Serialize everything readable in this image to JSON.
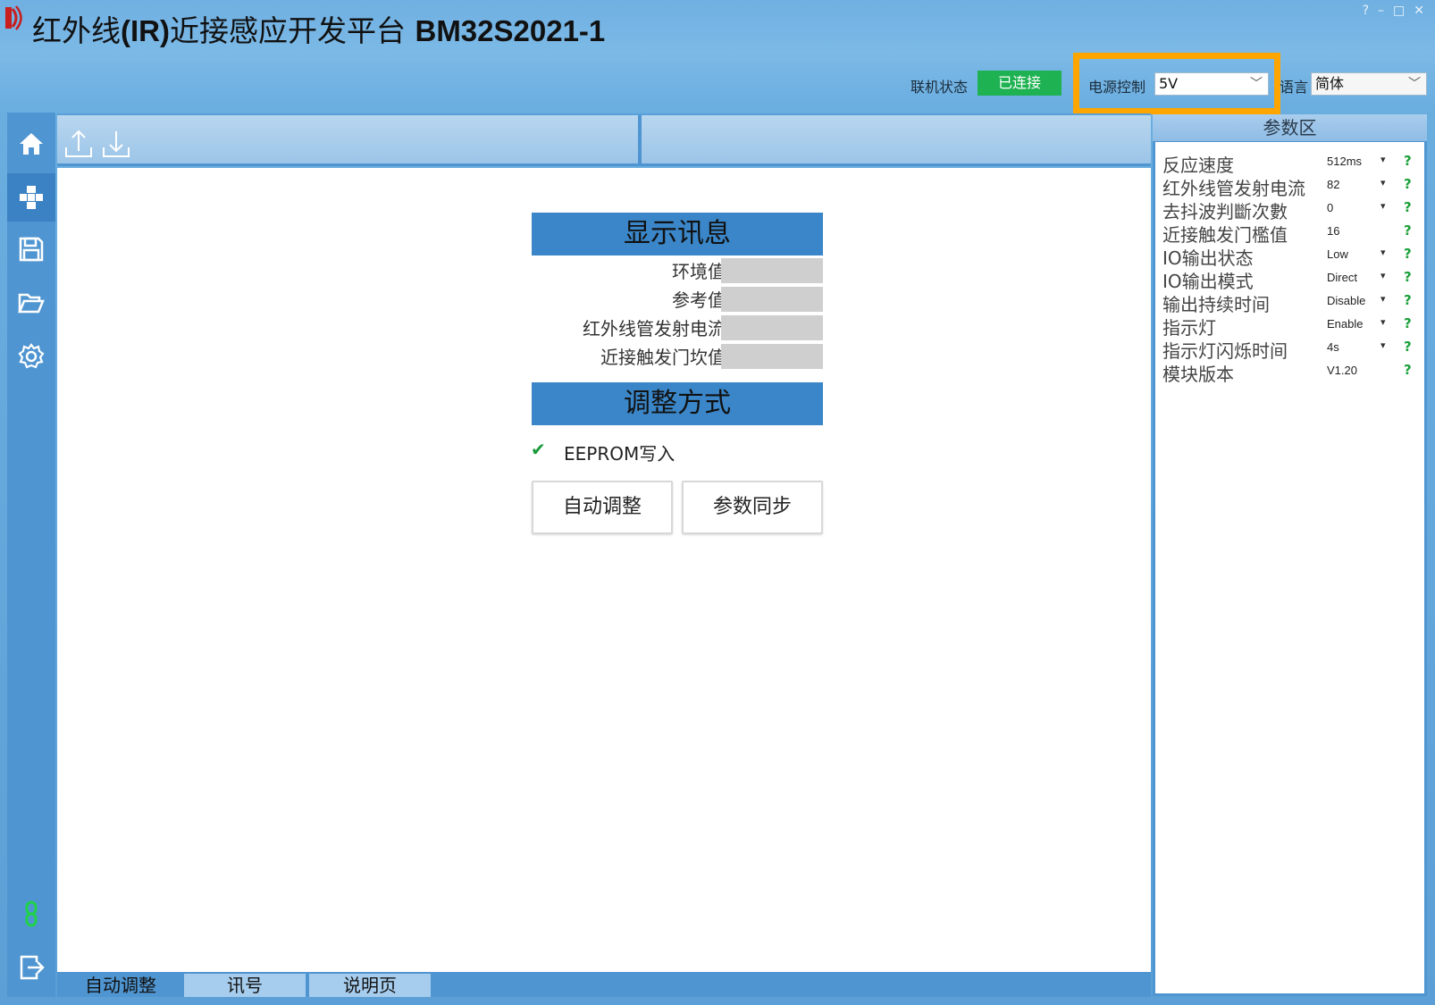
{
  "app": {
    "title_cn": "红外线",
    "title_ir": "(IR)",
    "title_cn2": "近接感应开发平台 ",
    "title_model": "BM32S2021-1"
  },
  "window": {
    "help": "?",
    "minimize": "–",
    "maximize": "□",
    "close": "✕"
  },
  "header": {
    "connection_label": "联机状态",
    "connection_status": "已连接",
    "power_label": "电源控制",
    "power_value": "5V",
    "language_label": "语言",
    "language_value": "简体",
    "status_color": "#1fb252",
    "highlight_color": "#ffa500"
  },
  "sidebar": {
    "items": [
      {
        "icon": "home-icon"
      },
      {
        "icon": "module-icon",
        "active": true
      },
      {
        "icon": "save-icon"
      },
      {
        "icon": "folder-open-icon"
      },
      {
        "icon": "gear-icon"
      },
      {
        "icon": "link-icon"
      },
      {
        "icon": "exit-icon"
      }
    ]
  },
  "toolbar": {
    "icons": [
      "upload-icon",
      "download-icon"
    ]
  },
  "display": {
    "header": "显示讯息",
    "rows": [
      {
        "label": "环境值",
        "value": ""
      },
      {
        "label": "参考值",
        "value": ""
      },
      {
        "label": "红外线管发射电流",
        "value": ""
      },
      {
        "label": "近接触发门坎值",
        "value": ""
      }
    ]
  },
  "adjust": {
    "header": "调整方式",
    "eeprom_check": "✔",
    "eeprom_label": "EEPROM写入",
    "auto_button": "自动调整",
    "sync_button": "参数同步"
  },
  "tabs": [
    {
      "label": "自动调整",
      "active": true
    },
    {
      "label": "讯号",
      "active": false
    },
    {
      "label": "说明页",
      "active": false
    }
  ],
  "params": {
    "title": "参数区",
    "rows": [
      {
        "label": "反应速度",
        "value": "512ms",
        "dropdown": true
      },
      {
        "label": "红外线管发射电流",
        "value": "82",
        "dropdown": true
      },
      {
        "label": "去抖波判斷次數",
        "value": "0",
        "dropdown": true
      },
      {
        "label": "近接触发门檻值",
        "value": "16",
        "dropdown": false
      },
      {
        "label": "IO输出状态",
        "value": "Low",
        "dropdown": true
      },
      {
        "label": "IO输出模式",
        "value": "Direct",
        "dropdown": true
      },
      {
        "label": "输出持续时间",
        "value": "Disable",
        "dropdown": true
      },
      {
        "label": "指示灯",
        "value": "Enable",
        "dropdown": true
      },
      {
        "label": "指示灯闪烁时间",
        "value": "4s",
        "dropdown": true
      },
      {
        "label": "模块版本",
        "value": "V1.20",
        "dropdown": false
      }
    ],
    "dropdown_glyph": "▾",
    "help_glyph": "?"
  }
}
